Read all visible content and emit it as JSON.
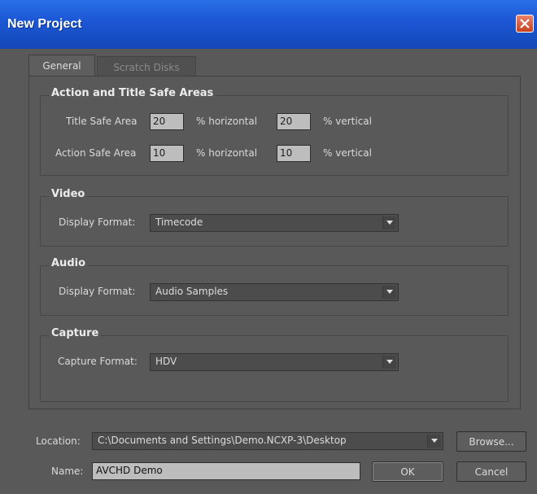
{
  "window": {
    "title": "New Project"
  },
  "tabs": [
    {
      "label": "General",
      "active": true
    },
    {
      "label": "Scratch Disks",
      "active": false
    }
  ],
  "safe_areas": {
    "title": "Action and Title Safe Areas",
    "title_safe": {
      "label": "Title Safe Area",
      "horizontal": "20",
      "horizontal_unit": "% horizontal",
      "vertical": "20",
      "vertical_unit": "% vertical"
    },
    "action_safe": {
      "label": "Action Safe Area",
      "horizontal": "10",
      "horizontal_unit": "% horizontal",
      "vertical": "10",
      "vertical_unit": "% vertical"
    }
  },
  "video": {
    "title": "Video",
    "display_format_label": "Display Format:",
    "display_format": "Timecode"
  },
  "audio": {
    "title": "Audio",
    "display_format_label": "Display Format:",
    "display_format": "Audio Samples"
  },
  "capture": {
    "title": "Capture",
    "capture_format_label": "Capture Format:",
    "capture_format": "HDV"
  },
  "location": {
    "label": "Location:",
    "value": "C:\\Documents and Settings\\Demo.NCXP-3\\Desktop",
    "browse_label": "Browse..."
  },
  "name": {
    "label": "Name:",
    "value": "AVCHD Demo"
  },
  "buttons": {
    "ok": "OK",
    "cancel": "Cancel"
  }
}
